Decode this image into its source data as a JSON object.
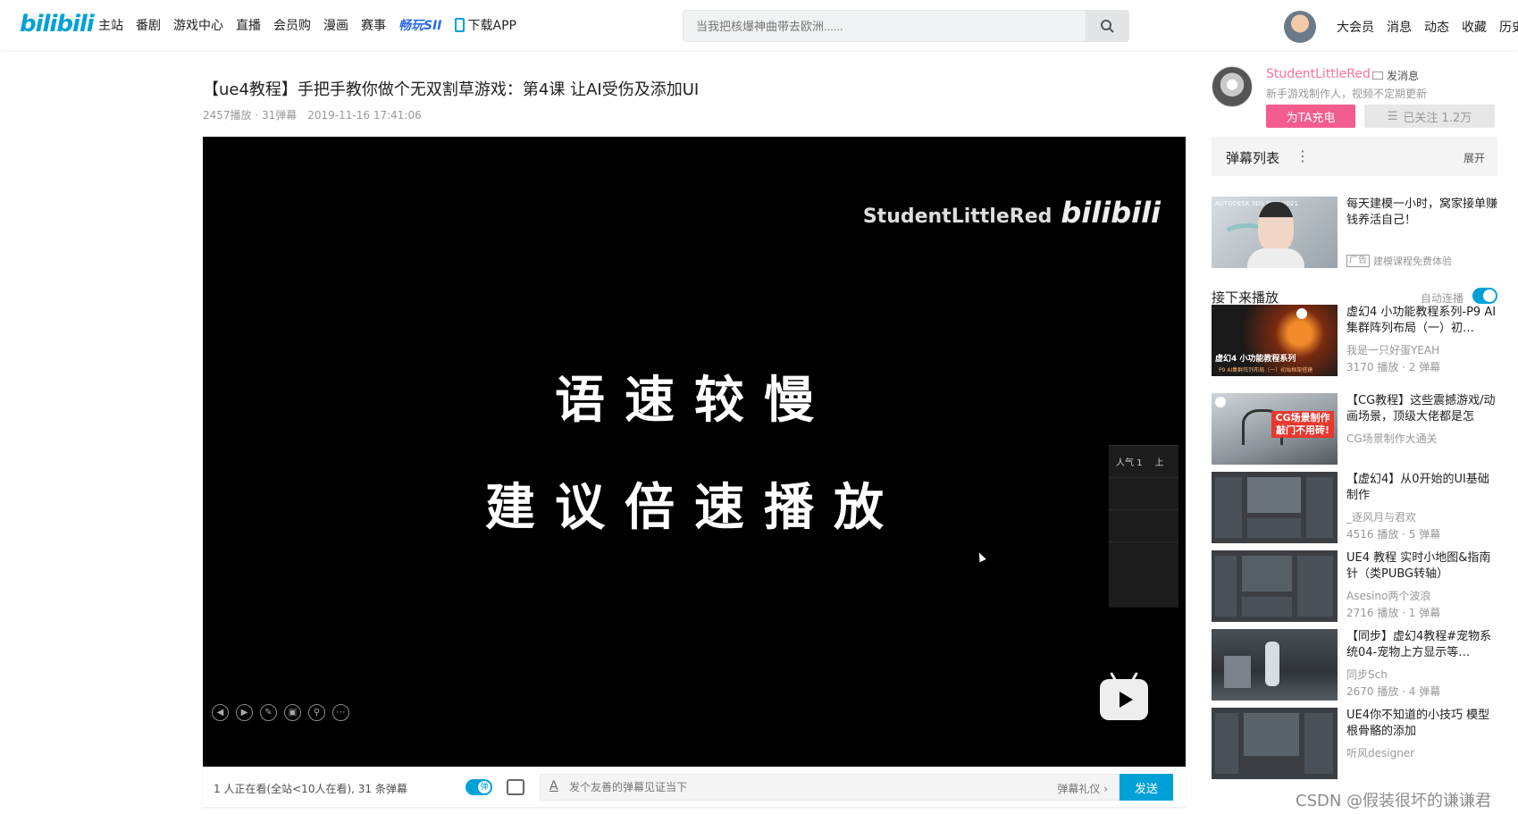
{
  "header": {
    "logo": "bilibili",
    "nav": [
      "主站",
      "番剧",
      "游戏中心",
      "直播",
      "会员购",
      "漫画",
      "赛事",
      "畅玩SII",
      "下载APP"
    ],
    "search_placeholder": "当我把核爆神曲带去欧洲......",
    "user_nav": [
      "大会员",
      "消息",
      "动态",
      "收藏",
      "历史"
    ]
  },
  "video": {
    "title": "【ue4教程】手把手教你做个无双割草游戏：第4课 让AI受伤及添加UI",
    "plays": "2457播放 · 31弹幕",
    "date": "2019-11-16 17:41:06",
    "watermark_name": "StudentLittleRed",
    "watermark_logo": "bilibili",
    "caption_line1": "语速较慢",
    "caption_line2": "建议倍速播放",
    "side_panel": [
      "人气 1",
      "上",
      "",
      "",
      ""
    ]
  },
  "danmaku_bar": {
    "watching": "1 人正在看(全站<10人在看), 31 条弹幕",
    "input_placeholder": "发个友善的弹幕见证当下",
    "etiquette": "弹幕礼仪 ›",
    "send": "发送"
  },
  "uploader": {
    "name": "StudentLittleRed",
    "message": "发消息",
    "desc": "新手游戏制作人，视频不定期更新",
    "charge": "为TA充电",
    "follow": "已关注 1.2万"
  },
  "danmaku_list": {
    "title": "弹幕列表",
    "expand": "展开"
  },
  "ad": {
    "title": "每天建模一小时，窝家接单赚钱养活自己！",
    "tag": "广告",
    "source": "建模课程免费体验",
    "thumb_label": "AUTODESK 3DS MAX 2021"
  },
  "next": {
    "title": "接下来播放",
    "autoplay": "自动连播"
  },
  "recommendations": [
    {
      "title": "虚幻4 小功能教程系列-P9 AI集群阵列布局（一）初…",
      "up": "我是一只好蛋YEAH",
      "stats": "3170 播放 · 2 弹幕",
      "thumb_text": "虚幻4 小功能教程系列",
      "thumb_sub": "P9 AI集群阵列布局（一）初始框架搭建"
    },
    {
      "title": "【CG教程】这些震撼游戏/动画场景，顶级大佬都是怎",
      "up": "CG场景制作大通关",
      "stats": "",
      "thumb_text": "CG场景制作 敲门不用砖!"
    },
    {
      "title": "【虚幻4】从0开始的UI基础制作",
      "up": "_逐风月与君欢",
      "stats": "4516 播放 · 5 弹幕"
    },
    {
      "title": "UE4 教程 实时小地图&指南针（类PUBG转轴）",
      "up": "Asesino两个波浪",
      "stats": "2716 播放 · 1 弹幕"
    },
    {
      "title": "【同步】虚幻4教程#宠物系统04-宠物上方显示等…",
      "up": "同步Sch",
      "stats": "2670 播放 · 4 弹幕"
    },
    {
      "title": "UE4你不知道的小技巧 模型根骨骼的添加",
      "up": "听风designer",
      "stats": "",
      "thumb_text": ""
    }
  ],
  "watermark": "CSDN @假装很坏的谦谦君"
}
